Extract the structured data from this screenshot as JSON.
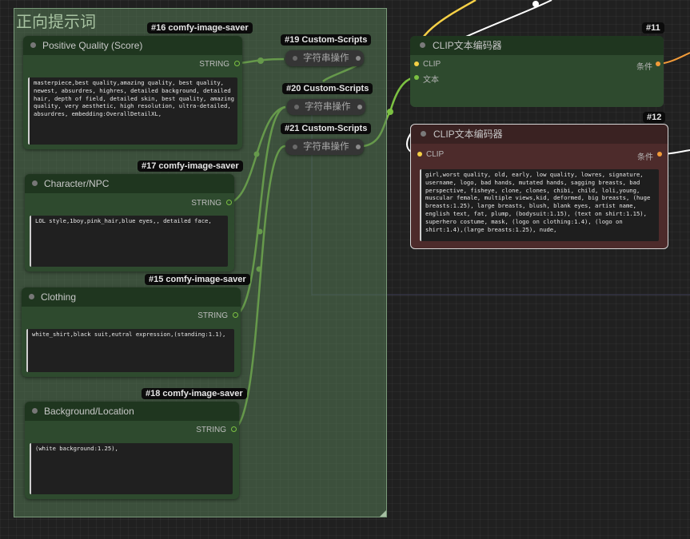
{
  "group": {
    "title": "正向提示词"
  },
  "nodes": {
    "quality": {
      "badge": "#16 comfy-image-saver",
      "title": "Positive Quality (Score)",
      "output_label": "STRING",
      "text": "masterpiece,best quality,amazing quality, best quality, newest, absurdres, highres,  detailed background, detailed hair, depth of field, detailed skin,  best quality, amazing quality, very aesthetic, high resolution, ultra-detailed, absurdres, embedding:OverallDetailXL,"
    },
    "character": {
      "badge": "#17 comfy-image-saver",
      "title": "Character/NPC",
      "output_label": "STRING",
      "text": "LOL style,1boy,pink_hair,blue eyes,,  detailed face,"
    },
    "clothing": {
      "badge": "#15 comfy-image-saver",
      "title": "Clothing",
      "output_label": "STRING",
      "text": "white_shirt,black suit,eutral expression,(standing:1.1),"
    },
    "background": {
      "badge": "#18 comfy-image-saver",
      "title": "Background/Location",
      "output_label": "STRING",
      "text": "(white background:1.25),"
    },
    "script19": {
      "badge": "#19 Custom-Scripts",
      "title": "字符串操作"
    },
    "script20": {
      "badge": "#20 Custom-Scripts",
      "title": "字符串操作"
    },
    "script21": {
      "badge": "#21 Custom-Scripts",
      "title": "字符串操作"
    },
    "clip11": {
      "badge": "#11",
      "title": "CLIP文本编码器",
      "input_clip": "CLIP",
      "input_text": "文本",
      "output": "条件"
    },
    "clip12": {
      "badge": "#12",
      "title": "CLIP文本编码器",
      "input_clip": "CLIP",
      "output": "条件",
      "text": "girl,worst quality, old, early, low quality, lowres, signature, username, logo, bad hands, mutated hands, sagging breasts,  bad perspective, fisheye,   clone, clones, chibi, child, loli,young, muscular female, multiple views,kid, deformed, big breasts, (huge breasts:1.25), large breasts, blush, blank eyes, artist name, english text, fat, plump, (bodysuit:1.15), (text on shirt:1.15),  superhero costume, mask, (logo on clothing:1.4), (logo on shirt:1.4),(large breasts:1.25), nude,"
    }
  },
  "colors": {
    "node_body": "#2e4a2e",
    "node_header": "#1f361f",
    "wire_string": "#7cc142",
    "wire_clip": "#f5d046",
    "wire_conditioning": "#f29b39",
    "negative_node": "#4a2a2a",
    "canvas": "#202020"
  }
}
